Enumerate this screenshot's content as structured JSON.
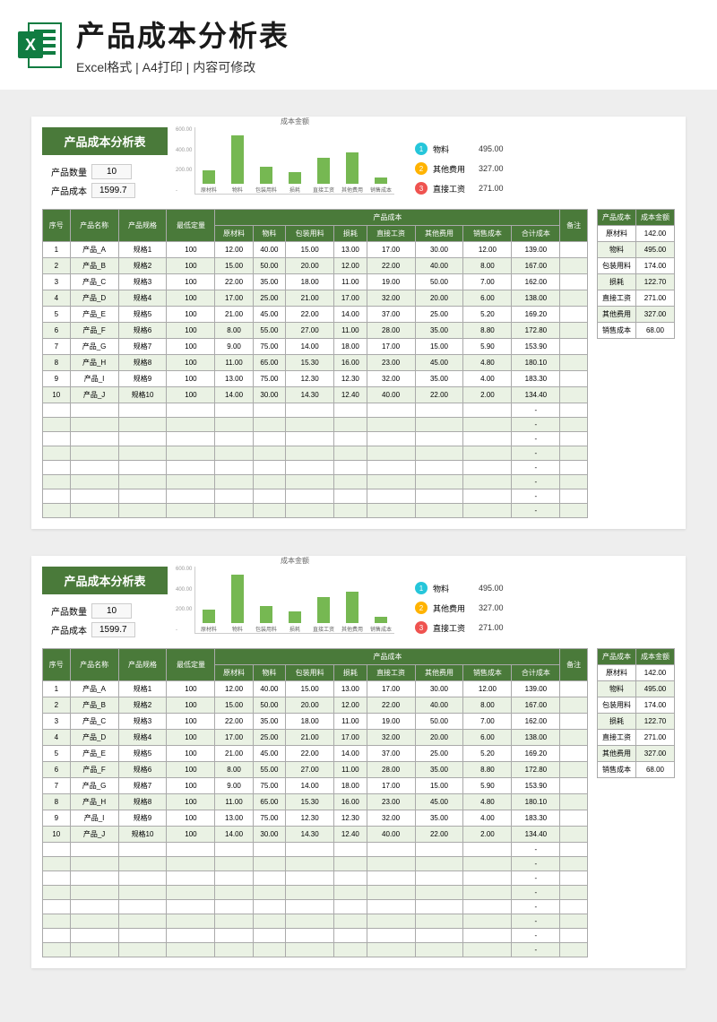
{
  "header": {
    "title": "产品成本分析表",
    "subtitle": "Excel格式 | A4打印 | 内容可修改",
    "icon_name": "excel-icon"
  },
  "sheet": {
    "title": "产品成本分析表",
    "info": {
      "qty_label": "产品数量",
      "qty_value": "10",
      "cost_label": "产品成本",
      "cost_value": "1599.7"
    },
    "headers": {
      "seq": "序号",
      "name": "产品名称",
      "spec": "产品规格",
      "min_qty": "最低定量",
      "cost_group": "产品成本",
      "raw": "原材料",
      "material": "物料",
      "packaging": "包装用料",
      "loss": "损耗",
      "labor": "直接工资",
      "other": "其他费用",
      "sales": "销售成本",
      "total": "合计成本",
      "remark": "备注"
    },
    "rows": [
      {
        "seq": "1",
        "name": "产品_A",
        "spec": "规格1",
        "min": "100",
        "raw": "12.00",
        "mat": "40.00",
        "pack": "15.00",
        "loss": "13.00",
        "labor": "17.00",
        "other": "30.00",
        "sales": "12.00",
        "total": "139.00",
        "remark": ""
      },
      {
        "seq": "2",
        "name": "产品_B",
        "spec": "规格2",
        "min": "100",
        "raw": "15.00",
        "mat": "50.00",
        "pack": "20.00",
        "loss": "12.00",
        "labor": "22.00",
        "other": "40.00",
        "sales": "8.00",
        "total": "167.00",
        "remark": ""
      },
      {
        "seq": "3",
        "name": "产品_C",
        "spec": "规格3",
        "min": "100",
        "raw": "22.00",
        "mat": "35.00",
        "pack": "18.00",
        "loss": "11.00",
        "labor": "19.00",
        "other": "50.00",
        "sales": "7.00",
        "total": "162.00",
        "remark": ""
      },
      {
        "seq": "4",
        "name": "产品_D",
        "spec": "规格4",
        "min": "100",
        "raw": "17.00",
        "mat": "25.00",
        "pack": "21.00",
        "loss": "17.00",
        "labor": "32.00",
        "other": "20.00",
        "sales": "6.00",
        "total": "138.00",
        "remark": ""
      },
      {
        "seq": "5",
        "name": "产品_E",
        "spec": "规格5",
        "min": "100",
        "raw": "21.00",
        "mat": "45.00",
        "pack": "22.00",
        "loss": "14.00",
        "labor": "37.00",
        "other": "25.00",
        "sales": "5.20",
        "total": "169.20",
        "remark": ""
      },
      {
        "seq": "6",
        "name": "产品_F",
        "spec": "规格6",
        "min": "100",
        "raw": "8.00",
        "mat": "55.00",
        "pack": "27.00",
        "loss": "11.00",
        "labor": "28.00",
        "other": "35.00",
        "sales": "8.80",
        "total": "172.80",
        "remark": ""
      },
      {
        "seq": "7",
        "name": "产品_G",
        "spec": "规格7",
        "min": "100",
        "raw": "9.00",
        "mat": "75.00",
        "pack": "14.00",
        "loss": "18.00",
        "labor": "17.00",
        "other": "15.00",
        "sales": "5.90",
        "total": "153.90",
        "remark": ""
      },
      {
        "seq": "8",
        "name": "产品_H",
        "spec": "规格8",
        "min": "100",
        "raw": "11.00",
        "mat": "65.00",
        "pack": "15.30",
        "loss": "16.00",
        "labor": "23.00",
        "other": "45.00",
        "sales": "4.80",
        "total": "180.10",
        "remark": ""
      },
      {
        "seq": "9",
        "name": "产品_I",
        "spec": "规格9",
        "min": "100",
        "raw": "13.00",
        "mat": "75.00",
        "pack": "12.30",
        "loss": "12.30",
        "labor": "32.00",
        "other": "35.00",
        "sales": "4.00",
        "total": "183.30",
        "remark": ""
      },
      {
        "seq": "10",
        "name": "产品_J",
        "spec": "规格10",
        "min": "100",
        "raw": "14.00",
        "mat": "30.00",
        "pack": "14.30",
        "loss": "12.40",
        "labor": "40.00",
        "other": "22.00",
        "sales": "2.00",
        "total": "134.40",
        "remark": ""
      }
    ],
    "empty_rows": 8,
    "side_table": {
      "h1": "产品成本",
      "h2": "成本金额",
      "rows": [
        {
          "name": "原材料",
          "val": "142.00"
        },
        {
          "name": "物料",
          "val": "495.00"
        },
        {
          "name": "包装用料",
          "val": "174.00"
        },
        {
          "name": "损耗",
          "val": "122.70"
        },
        {
          "name": "直接工资",
          "val": "271.00"
        },
        {
          "name": "其他费用",
          "val": "327.00"
        },
        {
          "name": "销售成本",
          "val": "68.00"
        }
      ]
    },
    "legend": [
      {
        "rank": "1",
        "label": "物料",
        "val": "495.00"
      },
      {
        "rank": "2",
        "label": "其他费用",
        "val": "327.00"
      },
      {
        "rank": "3",
        "label": "直接工资",
        "val": "271.00"
      }
    ]
  },
  "chart_data": {
    "type": "bar",
    "title": "成本金额",
    "categories": [
      "原材料",
      "物料",
      "包装用料",
      "损耗",
      "直接工资",
      "其他费用",
      "销售成本"
    ],
    "values": [
      142,
      495,
      174,
      122.7,
      271,
      327,
      68
    ],
    "ylim": [
      0,
      600
    ],
    "yticks": [
      "600.00",
      "400.00",
      "200.00",
      "-"
    ],
    "xlabel": "",
    "ylabel": ""
  }
}
